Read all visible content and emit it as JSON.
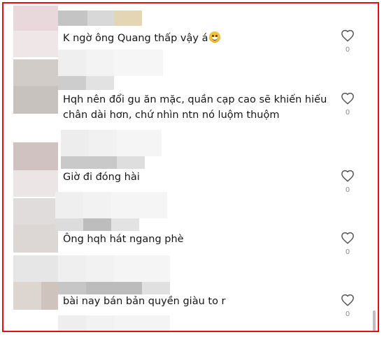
{
  "comments": [
    {
      "text": "K ngờ ông Quang thấp vậy á",
      "emoji": "grinning-sweat-emoji",
      "likes": "0"
    },
    {
      "text_lines": [
        "Hqh nên đổi gu ăn mặc, quần cạp cao sẽ khiến hiếu",
        "chân dài hơn, chứ nhìn ntn nó luộm thuộm"
      ],
      "likes": "0"
    },
    {
      "text": "Giờ đi đóng hài",
      "likes": "0"
    },
    {
      "text": "Ông hqh hát ngang phè",
      "likes": "0"
    },
    {
      "text": "bài nay bán bản quyền giàu to r",
      "likes": "0"
    }
  ],
  "colors": {
    "frame_border": "#e00f16",
    "text": "#161616",
    "muted": "#8a8a8a"
  },
  "icons": {
    "like": "heart-outline-icon"
  }
}
